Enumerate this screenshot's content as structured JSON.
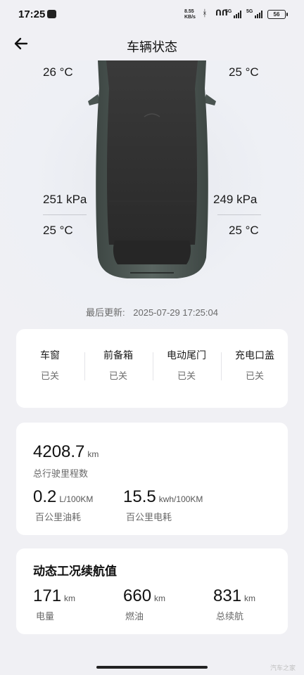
{
  "status_bar": {
    "time": "17:25",
    "net_speed_value": "8.55",
    "net_speed_unit": "KB/s",
    "sim1_label": "5G",
    "sim2_label": "5G",
    "battery": "56"
  },
  "header": {
    "title": "车辆状态",
    "back_icon": "arrow-left-icon"
  },
  "vehicle": {
    "front_left_temp": "26 °C",
    "front_right_temp": "25 °C",
    "rear_left_pressure": "251 kPa",
    "rear_right_pressure": "249 kPa",
    "rear_left_temp": "25 °C",
    "rear_right_temp": "25 °C",
    "car_icon": "car-top-view-icon"
  },
  "updated": {
    "label": "最后更新:",
    "time": "2025-07-29 17:25:04"
  },
  "closures": [
    {
      "label": "车窗",
      "value": "已关"
    },
    {
      "label": "前备箱",
      "value": "已关"
    },
    {
      "label": "电动尾门",
      "value": "已关"
    },
    {
      "label": "充电口盖",
      "value": "已关"
    }
  ],
  "stats": {
    "odometer": {
      "value": "4208.7",
      "unit": "km",
      "label": "总行驶里程数"
    },
    "fuel": {
      "value": "0.2",
      "unit": "L/100KM",
      "label": "百公里油耗"
    },
    "power": {
      "value": "15.5",
      "unit": "kwh/100KM",
      "label": "百公里电耗"
    }
  },
  "range": {
    "title": "动态工况续航值",
    "items": [
      {
        "value": "171",
        "unit": "km",
        "label": "电量"
      },
      {
        "value": "660",
        "unit": "km",
        "label": "燃油"
      },
      {
        "value": "831",
        "unit": "km",
        "label": "总续航"
      }
    ]
  },
  "watermark": "汽车之家",
  "colors": {
    "background": "#f0f0f4",
    "card": "#ffffff",
    "car_body": "#4c5753",
    "text_muted": "#6a6a6a"
  }
}
